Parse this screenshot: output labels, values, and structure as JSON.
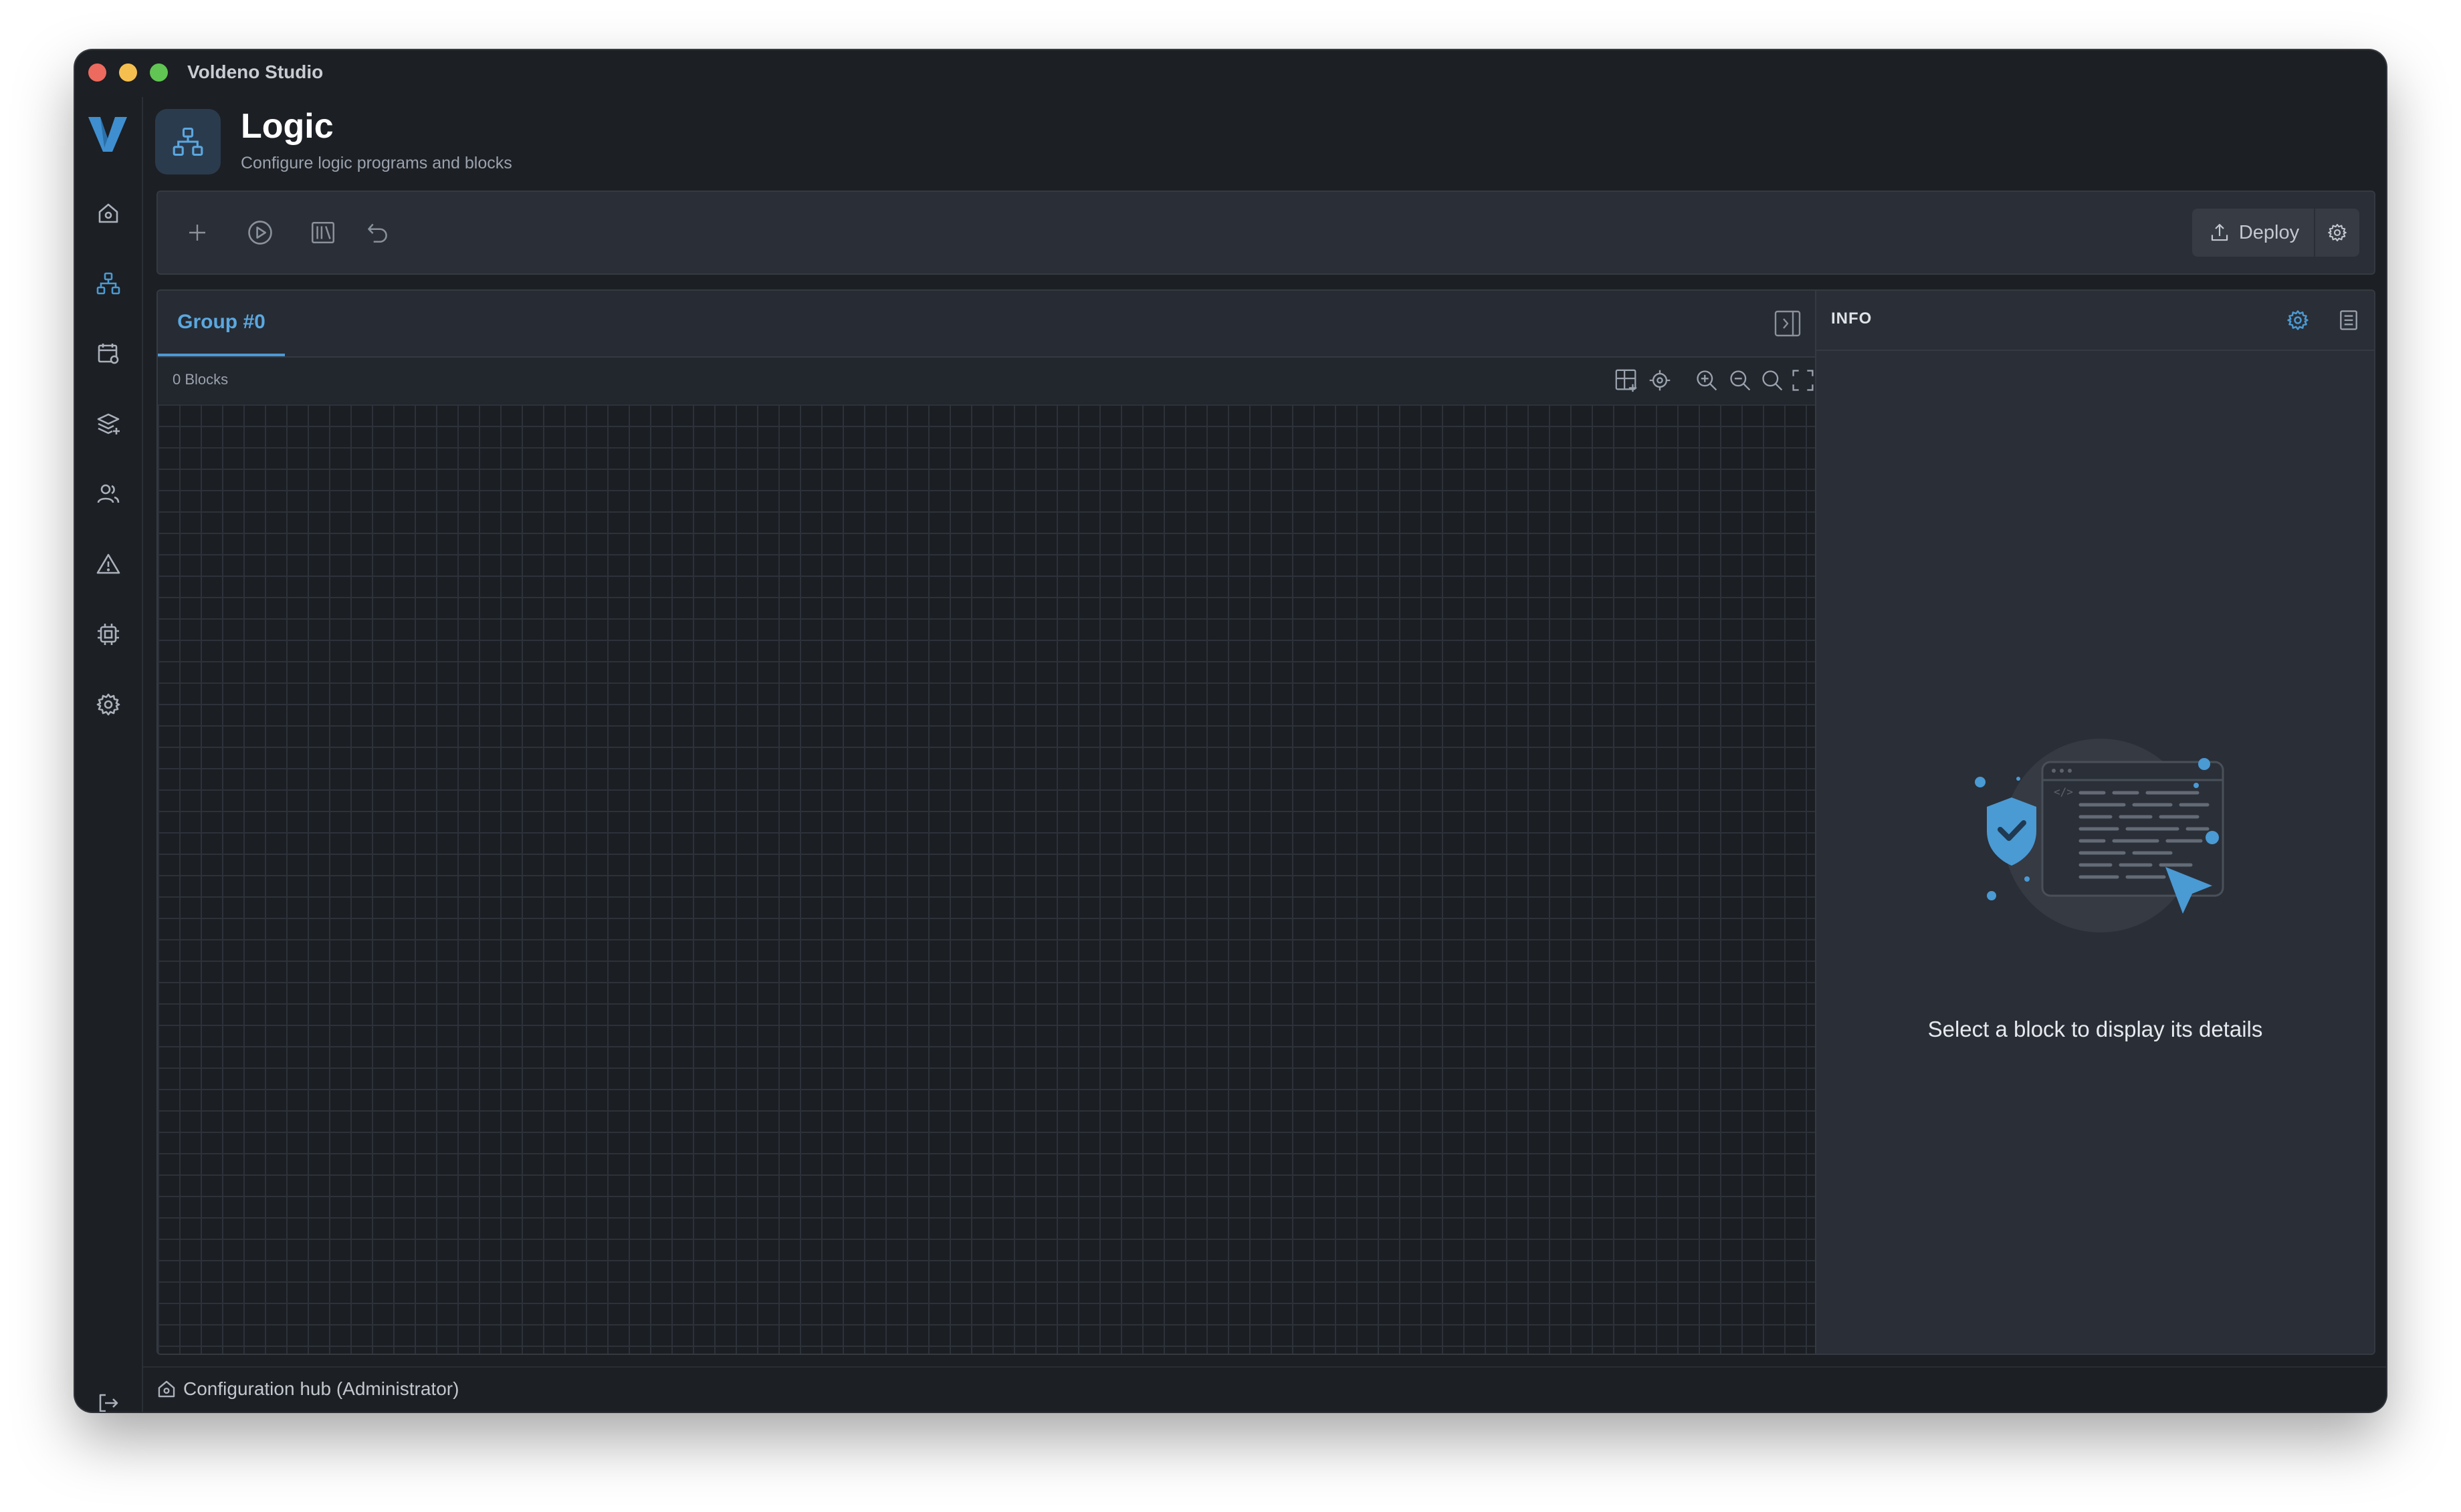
{
  "window": {
    "title": "Voldeno Studio",
    "traffic_lights": [
      "#ed6a5e",
      "#f5bf4f",
      "#61c554"
    ]
  },
  "sidebar": {
    "logo": "voldeno-logo",
    "items": [
      {
        "icon": "home-icon",
        "active": false
      },
      {
        "icon": "logic-network-icon",
        "active": true
      },
      {
        "icon": "calendar-settings-icon",
        "active": false
      },
      {
        "icon": "layers-add-icon",
        "active": false
      },
      {
        "icon": "users-icon",
        "active": false
      },
      {
        "icon": "warning-icon",
        "active": false
      },
      {
        "icon": "chip-icon",
        "active": false
      },
      {
        "icon": "gear-icon",
        "active": false
      }
    ],
    "bottom_icon": "logout-icon"
  },
  "header": {
    "icon": "logic-network-icon",
    "title": "Logic",
    "subtitle": "Configure logic programs and blocks"
  },
  "toolbar": {
    "tools": [
      "add-icon",
      "play-icon",
      "library-icon",
      "undo-icon"
    ],
    "deploy_label": "Deploy"
  },
  "canvas": {
    "tabs": [
      {
        "label": "Group #0",
        "active": true
      }
    ],
    "blocks_count": "0 Blocks",
    "controls": [
      "add-block-icon",
      "locate-icon",
      "zoom-in-icon",
      "zoom-out-icon",
      "zoom-fit-icon",
      "fullscreen-icon"
    ]
  },
  "info": {
    "title": "INFO",
    "empty_message": "Select a block to display its details"
  },
  "status": {
    "text": "Configuration hub (Administrator)"
  },
  "colors": {
    "accent": "#4a9ad4",
    "background": "#1c1f24",
    "panel": "#2a2e36"
  }
}
